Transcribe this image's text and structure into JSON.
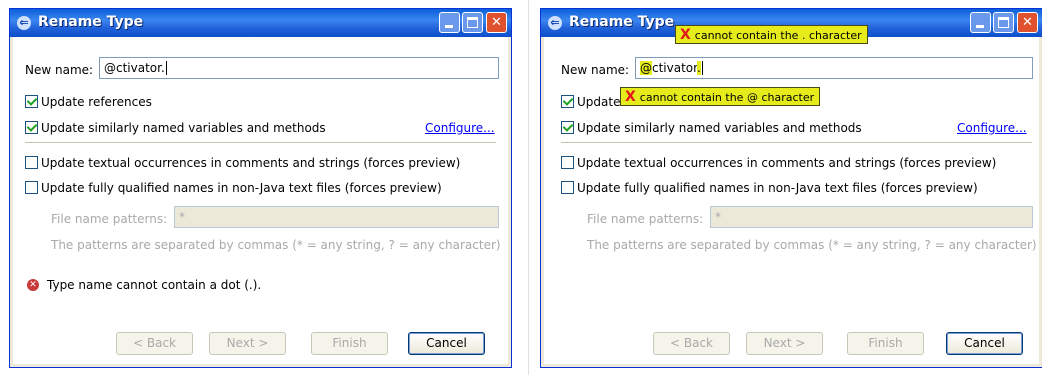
{
  "left": {
    "title": "Rename Type",
    "new_name_label": "New name:",
    "new_name_value": "@ctivator.",
    "update_references": "Update references",
    "update_similar": "Update similarly named variables and methods",
    "configure": "Configure...",
    "update_textual": "Update textual occurrences in comments and strings (forces preview)",
    "update_qualified": "Update fully qualified names in non-Java text files (forces preview)",
    "file_patterns_label": "File name patterns:",
    "file_patterns_value": "*",
    "patterns_hint": "The patterns are separated by commas (* = any string, ? = any character)",
    "error_message": "Type name cannot contain a dot (.).",
    "buttons": {
      "back": "< Back",
      "next": "Next >",
      "finish": "Finish",
      "cancel": "Cancel"
    }
  },
  "right": {
    "title": "Rename Type",
    "new_name_label": "New name:",
    "new_name_at": "@",
    "new_name_rest": "ctivator",
    "new_name_dot": ".",
    "update_references": "Update",
    "update_similar": "Update similarly named variables and methods",
    "configure": "Configure...",
    "update_textual": "Update textual occurrences in comments and strings (forces preview)",
    "update_qualified": "Update fully qualified names in non-Java text files (forces preview)",
    "file_patterns_label": "File name patterns:",
    "file_patterns_value": "*",
    "patterns_hint": "The patterns are separated by commas (* = any string, ? = any character)",
    "tooltip_dot": "cannot contain the . character",
    "tooltip_at": "cannot contain the @ character",
    "tooltip_mark": "X",
    "buttons": {
      "back": "< Back",
      "next": "Next >",
      "finish": "Finish",
      "cancel": "Cancel"
    }
  },
  "colors": {
    "title_bar": "#2060d8",
    "dialog_bg": "#ece9d8",
    "tooltip_bg": "#e6ec1c",
    "error_red": "#c93a3a",
    "link": "#0000ff"
  },
  "icons": {
    "title": "eclipse-rename-icon",
    "error": "error-circle-icon",
    "minimize": "minimize-icon",
    "maximize": "maximize-icon",
    "close": "close-icon"
  }
}
